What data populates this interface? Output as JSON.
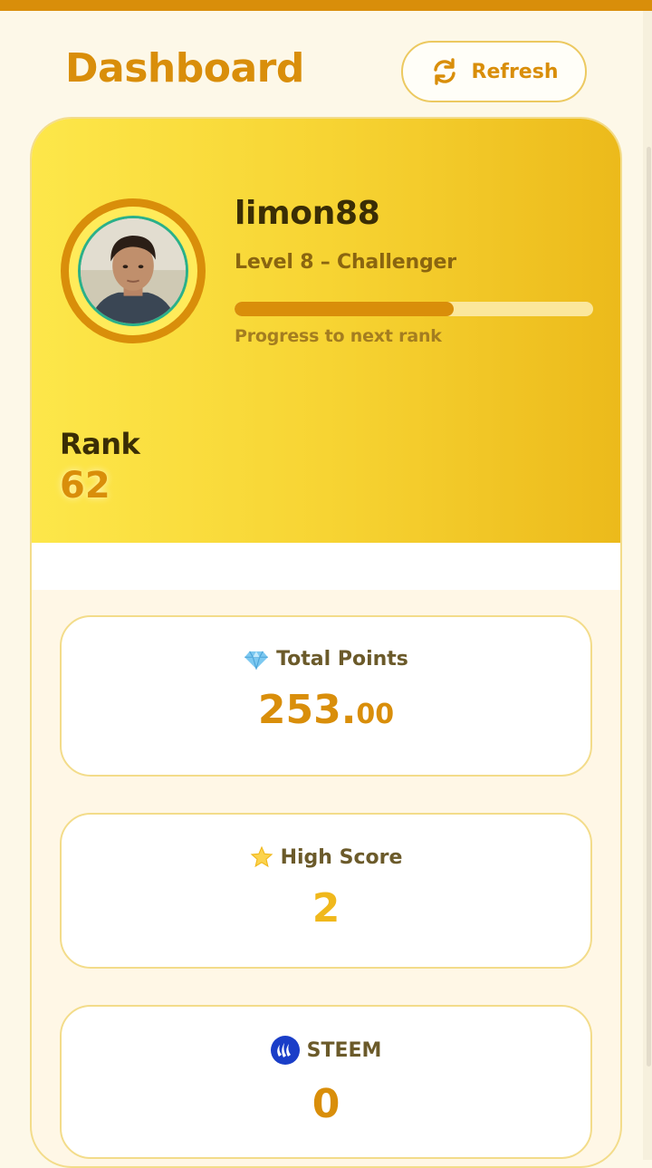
{
  "header": {
    "title": "Dashboard",
    "refresh_label": "Refresh"
  },
  "profile": {
    "username": "limon88",
    "level_text": "Level 8 – Challenger",
    "progress_fraction": 0.61,
    "progress_caption": "Progress to next rank",
    "rank_label": "Rank",
    "rank_value": "62"
  },
  "stats": {
    "total_points": {
      "label": "Total Points",
      "value_whole": "253.",
      "value_decimals": "00",
      "icon": "diamond-icon"
    },
    "high_score": {
      "label": "High Score",
      "value": "2",
      "icon": "star-icon"
    },
    "steem": {
      "label": "STEEM",
      "value": "0",
      "icon": "steem-logo-icon"
    }
  },
  "colors": {
    "accent": "#d98e0a",
    "gold": "#f0b81c",
    "hero_gradient_start": "#fde74a",
    "hero_gradient_end": "#ecba1b",
    "page_background": "#fdf8e8"
  }
}
